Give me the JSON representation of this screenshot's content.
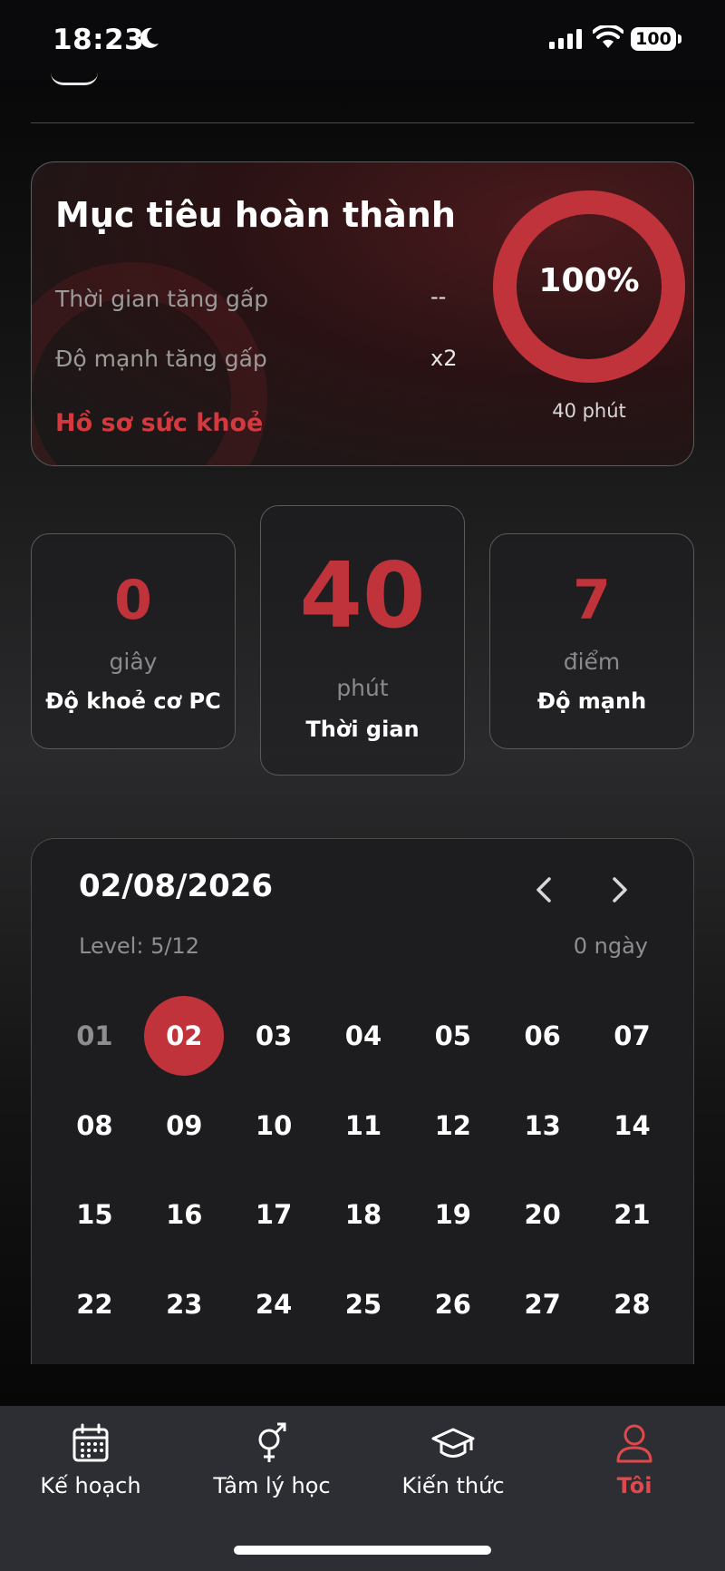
{
  "status": {
    "time": "18:23",
    "battery": "100"
  },
  "goal": {
    "title": "Mục tiêu hoàn thành",
    "rows": [
      {
        "label": "Thời gian tăng gấp",
        "value": "--"
      },
      {
        "label": "Độ mạnh tăng gấp",
        "value": "x2"
      }
    ],
    "link": "Hồ sơ sức khoẻ",
    "percent_label": "100%",
    "progress": 1.0,
    "duration": "40 phút"
  },
  "stats": [
    {
      "value": "0",
      "unit": "giây",
      "label": "Độ khoẻ cơ PC"
    },
    {
      "value": "40",
      "unit": "phút",
      "label": "Thời gian"
    },
    {
      "value": "7",
      "unit": "điểm",
      "label": "Độ mạnh"
    }
  ],
  "calendar": {
    "date": "02/08/2026",
    "level": "Level: 5/12",
    "days_count": "0 ngày",
    "selected": "02",
    "past": [
      "01"
    ],
    "days": [
      "01",
      "02",
      "03",
      "04",
      "05",
      "06",
      "07",
      "08",
      "09",
      "10",
      "11",
      "12",
      "13",
      "14",
      "15",
      "16",
      "17",
      "18",
      "19",
      "20",
      "21",
      "22",
      "23",
      "24",
      "25",
      "26",
      "27",
      "28"
    ]
  },
  "tabs": [
    {
      "label": "Kế hoạch",
      "icon": "calendar-icon"
    },
    {
      "label": "Tâm lý học",
      "icon": "gender-icon"
    },
    {
      "label": "Kiến thức",
      "icon": "graduation-cap-icon"
    },
    {
      "label": "Tôi",
      "icon": "user-icon",
      "active": true
    }
  ],
  "colors": {
    "accent": "#c1333a",
    "tab_active": "#e0494c"
  }
}
